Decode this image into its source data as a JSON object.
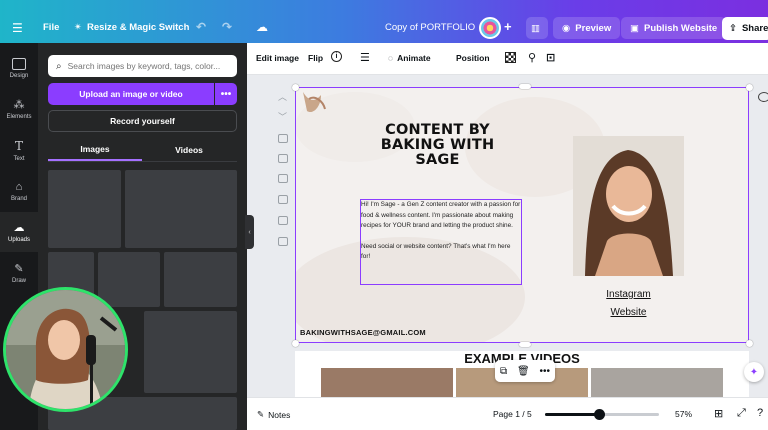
{
  "topbar": {
    "menu_icon": "hamburger-icon",
    "file": "File",
    "resize": "Resize & Magic Switch",
    "doc_title": "Copy of PORTFOLIO",
    "preview": "Preview",
    "publish": "Publish Website",
    "share": "Share"
  },
  "rail": [
    {
      "label": "Design",
      "icon": "design-icon"
    },
    {
      "label": "Elements",
      "icon": "elements-icon"
    },
    {
      "label": "Text",
      "icon": "text-icon"
    },
    {
      "label": "Brand",
      "icon": "brand-icon"
    },
    {
      "label": "Uploads",
      "icon": "uploads-icon"
    },
    {
      "label": "Draw",
      "icon": "draw-icon"
    }
  ],
  "panel": {
    "search_placeholder": "Search images by keyword, tags, color...",
    "upload": "Upload an image or video",
    "record": "Record yourself",
    "tab_images": "Images",
    "tab_videos": "Videos"
  },
  "ctxbar": {
    "edit_image": "Edit image",
    "flip": "Flip",
    "animate": "Animate",
    "position": "Position"
  },
  "canvas": {
    "headline": "CONTENT BY BAKING WITH SAGE",
    "body_p1": "Hi! I'm Sage - a Gen Z content creator with a passion for food & wellness content. I'm passionate about making recipes for YOUR brand and letting the product shine.",
    "body_p2": "Need social or website content? That's what I'm here for!",
    "instagram": "Instagram",
    "website": "Website",
    "email": "BAKINGWITHSAGE@GMAIL.COM",
    "example_title": "EXAMPLE VIDEOS"
  },
  "bottombar": {
    "notes": "Notes",
    "page": "Page 1 / 5",
    "zoom": "57%",
    "zoom_level": 0.47
  },
  "colors": {
    "accent": "#8b3dff",
    "webcam_ring": "#2ee36a"
  }
}
